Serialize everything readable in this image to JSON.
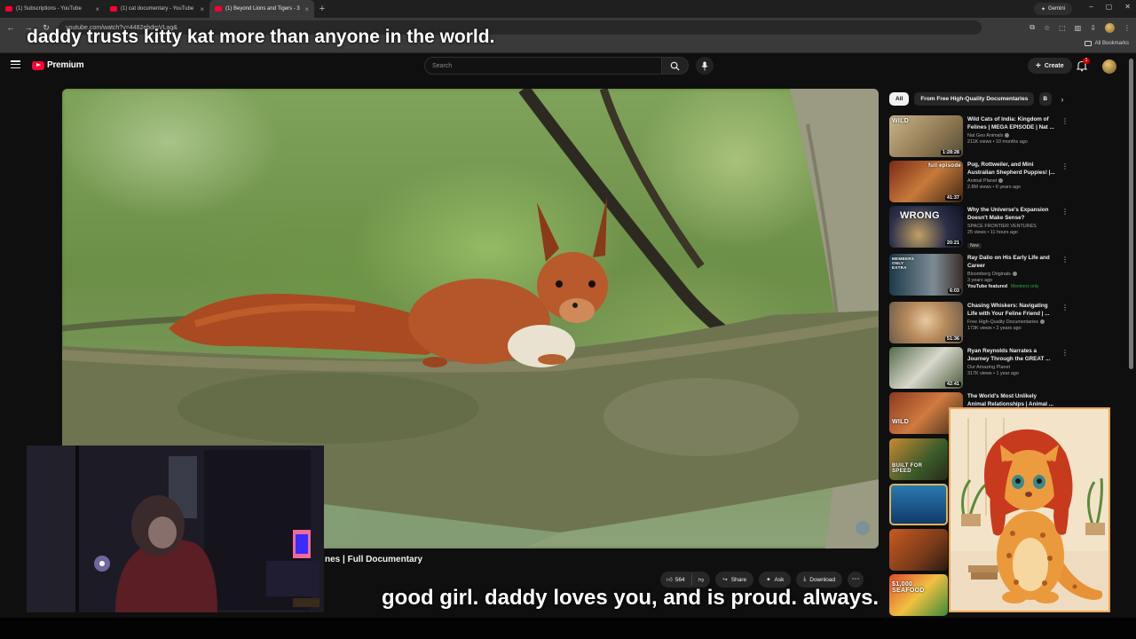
{
  "browser": {
    "tabs": [
      {
        "label": "(1) Subscriptions - YouTube"
      },
      {
        "label": "(1) cat documentary - YouTube"
      },
      {
        "label": "(1) Beyond Lions and Tigers - 3"
      }
    ],
    "gemini_label": "Gemini",
    "url": "youtube.com/watch?v=4482ebdmVLag&",
    "all_bookmarks": "All Bookmarks"
  },
  "masthead": {
    "logo_text": "Premium",
    "search_placeholder": "Search",
    "create_label": "Create",
    "notification_count": "1"
  },
  "video": {
    "title_visible": "nes | Full Documentary"
  },
  "actions": {
    "likes": "564",
    "share": "Share",
    "ask": "Ask",
    "download": "Download"
  },
  "chips": [
    "All",
    "From Free High-Quality Documentaries",
    "B"
  ],
  "recommendations": [
    {
      "title": "Wild Cats of India: Kingdom of Felines | MEGA EPISODE | Nat ...",
      "channel": "Nat Geo Animals",
      "views": "211K views • 10 months ago",
      "duration": "1:28:28",
      "thumb_text": "WILD"
    },
    {
      "title": "Pug, Rottweiler, and Mini Australian Shepherd Puppies! |...",
      "channel": "Animal Planet",
      "views": "2.8M views • 6 years ago",
      "duration": "41:37",
      "thumb_text": "full episode"
    },
    {
      "title": "Why the Universe's Expansion Doesn't Make Sense?",
      "channel": "SPACE FRONTIER VENTURES",
      "views": "25 views • 11 hours ago",
      "duration": "20:21",
      "thumb_text": "WRONG",
      "badge": "New"
    },
    {
      "title": "Ray Dalio on His Early Life and Career",
      "channel": "Bloomberg Originals",
      "views": "3 years ago",
      "duration": "6:03",
      "thumb_text": "MEMBERS ONLY EXTRA",
      "featured": "YouTube featured",
      "member": "Members only"
    },
    {
      "title": "Chasing Whiskers: Navigating Life with Your Feline Friend | ...",
      "channel": "Free High-Quality Documentaries",
      "views": "173K views • 2 years ago",
      "duration": "51:36",
      "thumb_text": ""
    },
    {
      "title": "Ryan Reynolds Narrates a Journey Through the GREAT ...",
      "channel": "Our Amazing Planet",
      "views": "317K views • 1 year ago",
      "duration": "42:41",
      "thumb_text": ""
    },
    {
      "title": "The World's Most Unlikely Animal Relationships | Animal ...",
      "channel": "",
      "views": "",
      "duration": "",
      "thumb_text": "WILD"
    },
    {
      "title": "",
      "channel": "",
      "views": "",
      "duration": "",
      "thumb_text": "BUILT FOR SPEED"
    },
    {
      "title": "",
      "channel": "",
      "views": "",
      "duration": "",
      "thumb_text": ""
    },
    {
      "title": "",
      "channel": "",
      "views": "",
      "duration": "",
      "thumb_text": ""
    },
    {
      "title": "",
      "channel": "",
      "views": "",
      "duration": "",
      "thumb_text": "$1,000 SEAFOOD"
    }
  ],
  "captions": {
    "top": "daddy trusts kitty kat more than anyone in the world.",
    "bottom": "good girl. daddy loves you, and is proud. always."
  },
  "colors": {
    "youtube_red": "#ff0033",
    "background": "#0f0f0f",
    "chip_bg": "#272727",
    "art_border": "#e8a85a"
  }
}
